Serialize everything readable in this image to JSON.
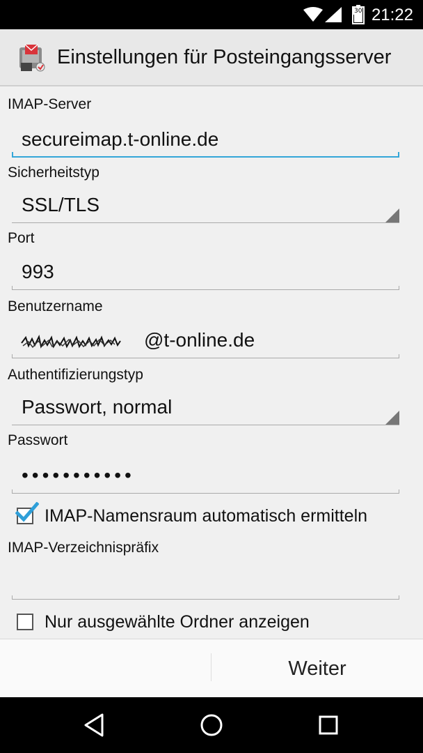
{
  "status_bar": {
    "time": "21:22",
    "battery_level": "30",
    "icons": [
      "wifi-icon",
      "cell-signal-icon",
      "battery-icon"
    ]
  },
  "action_bar": {
    "title": "Einstellungen für Posteingangsserver",
    "app_icon": "mail-app-icon"
  },
  "form": {
    "imap_server": {
      "label": "IMAP-Server",
      "value": "secureimap.t-online.de"
    },
    "security_type": {
      "label": "Sicherheitstyp",
      "value": "SSL/TLS"
    },
    "port": {
      "label": "Port",
      "value": "993"
    },
    "username": {
      "label": "Benutzername",
      "domain_suffix": "@t-online.de"
    },
    "auth_type": {
      "label": "Authentifizierungstyp",
      "value": "Passwort, normal"
    },
    "password": {
      "label": "Passwort",
      "masked_value": "•••••••••••"
    },
    "namespace_checkbox": {
      "label": "IMAP-Namensraum automatisch ermitteln",
      "checked": true
    },
    "prefix": {
      "label": "IMAP-Verzeichnispräfix",
      "value": ""
    },
    "subscribed_checkbox": {
      "label": "Nur ausgewählte Ordner anzeigen",
      "checked": false
    }
  },
  "bottom_bar": {
    "next_label": "Weiter"
  },
  "colors": {
    "accent": "#33a6d8",
    "check_blue": "#2f9fd8",
    "background": "#f0f0f0"
  }
}
